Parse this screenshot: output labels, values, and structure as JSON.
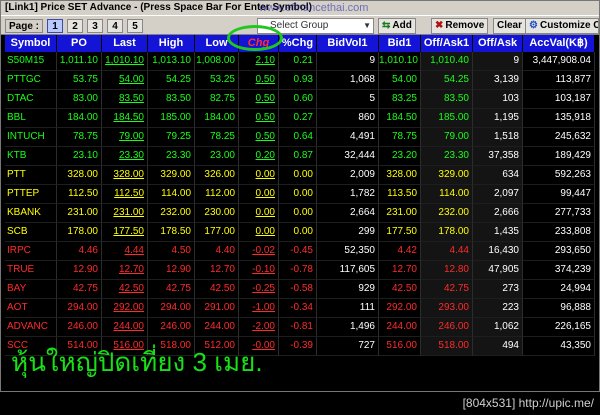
{
  "window": {
    "title": "[Link1] Price SET Advance  - (Press Space Bar For Enter Symbol)",
    "watermark": "www.efinancethai.com"
  },
  "toolbar": {
    "page_label": "Page :",
    "pages": [
      "1",
      "2",
      "3",
      "4",
      "5"
    ],
    "active_page": "1",
    "select_group_placeholder": "Select Group",
    "add_label": "Add",
    "remove_label": "Remove",
    "clear_label": "Clear",
    "customize_label": "Customize Col"
  },
  "columns": [
    "Symbol",
    "PO",
    "Last",
    "High",
    "Low",
    "Chg",
    "%Chg",
    "BidVol1",
    "Bid1",
    "Off/Ask1",
    "Off/Ask",
    "AccVal(K฿)"
  ],
  "rows": [
    {
      "symbol": "S50M15",
      "po": "1,011.10",
      "last": "1,010.10",
      "high": "1,013.10",
      "low": "1,008.00",
      "chg": "2.10",
      "pchg": "0.21",
      "bidvol": "9",
      "bid": "1,010.10",
      "ask": "1,010.40",
      "askvol": "9",
      "accval": "3,447,908.04",
      "dir": "up"
    },
    {
      "symbol": "PTTGC",
      "po": "53.75",
      "last": "54.00",
      "high": "54.25",
      "low": "53.25",
      "chg": "0.50",
      "pchg": "0.93",
      "bidvol": "1,068",
      "bid": "54.00",
      "ask": "54.25",
      "askvol": "3,139",
      "accval": "113,877",
      "dir": "up"
    },
    {
      "symbol": "DTAC",
      "po": "83.00",
      "last": "83.50",
      "high": "83.50",
      "low": "82.75",
      "chg": "0.50",
      "pchg": "0.60",
      "bidvol": "5",
      "bid": "83.25",
      "ask": "83.50",
      "askvol": "103",
      "accval": "103,187",
      "dir": "up"
    },
    {
      "symbol": "BBL",
      "po": "184.00",
      "last": "184.50",
      "high": "185.00",
      "low": "184.00",
      "chg": "0.50",
      "pchg": "0.27",
      "bidvol": "860",
      "bid": "184.50",
      "ask": "185.00",
      "askvol": "1,195",
      "accval": "135,918",
      "dir": "up"
    },
    {
      "symbol": "INTUCH",
      "po": "78.75",
      "last": "79.00",
      "high": "79.25",
      "low": "78.25",
      "chg": "0.50",
      "pchg": "0.64",
      "bidvol": "4,491",
      "bid": "78.75",
      "ask": "79.00",
      "askvol": "1,518",
      "accval": "245,632",
      "dir": "up"
    },
    {
      "symbol": "KTB",
      "po": "23.10",
      "last": "23.30",
      "high": "23.30",
      "low": "23.00",
      "chg": "0.20",
      "pchg": "0.87",
      "bidvol": "32,444",
      "bid": "23.20",
      "ask": "23.30",
      "askvol": "37,358",
      "accval": "189,429",
      "dir": "up"
    },
    {
      "symbol": "PTT",
      "po": "328.00",
      "last": "328.00",
      "high": "329.00",
      "low": "326.00",
      "chg": "0.00",
      "pchg": "0.00",
      "bidvol": "2,009",
      "bid": "328.00",
      "ask": "329.00",
      "askvol": "634",
      "accval": "592,263",
      "dir": "flat"
    },
    {
      "symbol": "PTTEP",
      "po": "112.50",
      "last": "112.50",
      "high": "114.00",
      "low": "112.00",
      "chg": "0.00",
      "pchg": "0.00",
      "bidvol": "1,782",
      "bid": "113.50",
      "ask": "114.00",
      "askvol": "2,097",
      "accval": "99,447",
      "dir": "flat"
    },
    {
      "symbol": "KBANK",
      "po": "231.00",
      "last": "231.00",
      "high": "232.00",
      "low": "230.00",
      "chg": "0.00",
      "pchg": "0.00",
      "bidvol": "2,664",
      "bid": "231.00",
      "ask": "232.00",
      "askvol": "2,666",
      "accval": "277,733",
      "dir": "flat"
    },
    {
      "symbol": "SCB",
      "po": "178.00",
      "last": "177.50",
      "high": "178.50",
      "low": "177.00",
      "chg": "0.00",
      "pchg": "0.00",
      "bidvol": "299",
      "bid": "177.50",
      "ask": "178.00",
      "askvol": "1,435",
      "accval": "233,808",
      "dir": "flat"
    },
    {
      "symbol": "IRPC",
      "po": "4.46",
      "last": "4.44",
      "high": "4.50",
      "low": "4.40",
      "chg": "-0.02",
      "pchg": "-0.45",
      "bidvol": "52,350",
      "bid": "4.42",
      "ask": "4.44",
      "askvol": "16,430",
      "accval": "293,650",
      "dir": "down"
    },
    {
      "symbol": "TRUE",
      "po": "12.90",
      "last": "12.70",
      "high": "12.90",
      "low": "12.70",
      "chg": "-0.10",
      "pchg": "-0.78",
      "bidvol": "117,605",
      "bid": "12.70",
      "ask": "12.80",
      "askvol": "47,905",
      "accval": "374,239",
      "dir": "down"
    },
    {
      "symbol": "BAY",
      "po": "42.75",
      "last": "42.50",
      "high": "42.75",
      "low": "42.50",
      "chg": "-0.25",
      "pchg": "-0.58",
      "bidvol": "929",
      "bid": "42.50",
      "ask": "42.75",
      "askvol": "273",
      "accval": "24,994",
      "dir": "down"
    },
    {
      "symbol": "AOT",
      "po": "294.00",
      "last": "292.00",
      "high": "294.00",
      "low": "291.00",
      "chg": "-1.00",
      "pchg": "-0.34",
      "bidvol": "111",
      "bid": "292.00",
      "ask": "293.00",
      "askvol": "223",
      "accval": "96,888",
      "dir": "down"
    },
    {
      "symbol": "ADVANC",
      "po": "246.00",
      "last": "244.00",
      "high": "246.00",
      "low": "244.00",
      "chg": "-2.00",
      "pchg": "-0.81",
      "bidvol": "1,496",
      "bid": "244.00",
      "ask": "246.00",
      "askvol": "1,062",
      "accval": "226,165",
      "dir": "down"
    },
    {
      "symbol": "SCC",
      "po": "514.00",
      "last": "516.00",
      "high": "518.00",
      "low": "512.00",
      "chg": "-0.00",
      "pchg": "-0.39",
      "bidvol": "727",
      "bid": "516.00",
      "ask": "518.00",
      "askvol": "494",
      "accval": "43,350",
      "dir": "down"
    }
  ],
  "caption": "หุ้นใหญ่ปิดเที่ยง 3 เมย.",
  "status_bar": "[804x531] http://upic.me/",
  "colors": {
    "header_bg": "#1414d6",
    "up": "#17ff17",
    "down": "#ff2a2a",
    "unchanged": "#ffff00",
    "highlight_circle": "#1ec81e"
  },
  "icons": {
    "add": "add-icon",
    "remove": "remove-icon",
    "customize": "customize-icon",
    "dropdown": "chevron-down-icon"
  }
}
